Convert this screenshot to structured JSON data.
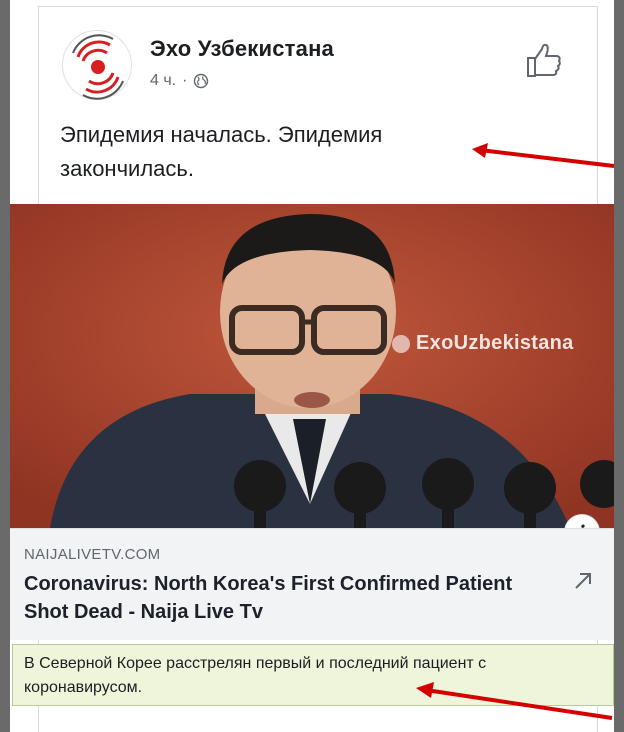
{
  "post": {
    "page_name": "Эхо Узбекистана",
    "time_ago": "4 ч.",
    "separator": "·",
    "text": "Эпидемия началась. Эпидемия закончилась."
  },
  "photo": {
    "watermark": "ExoUzbekistana"
  },
  "link": {
    "domain": "NAIJALIVETV.COM",
    "title": "Coronavirus: North Korea's First Confirmed Patient Shot Dead - Naija Live Tv"
  },
  "caption": {
    "text": "В Северной Корее расстрелян первый и последний пациент с коронавирусом."
  },
  "icons": {
    "avatar": "echo-logo-icon",
    "privacy": "globe-icon",
    "like": "thumbs-up-icon",
    "info": "info-icon",
    "external": "external-link-icon"
  },
  "colors": {
    "arrow": "#d40000",
    "logo_red": "#d81e1e",
    "caption_bg": "#eef5db"
  }
}
